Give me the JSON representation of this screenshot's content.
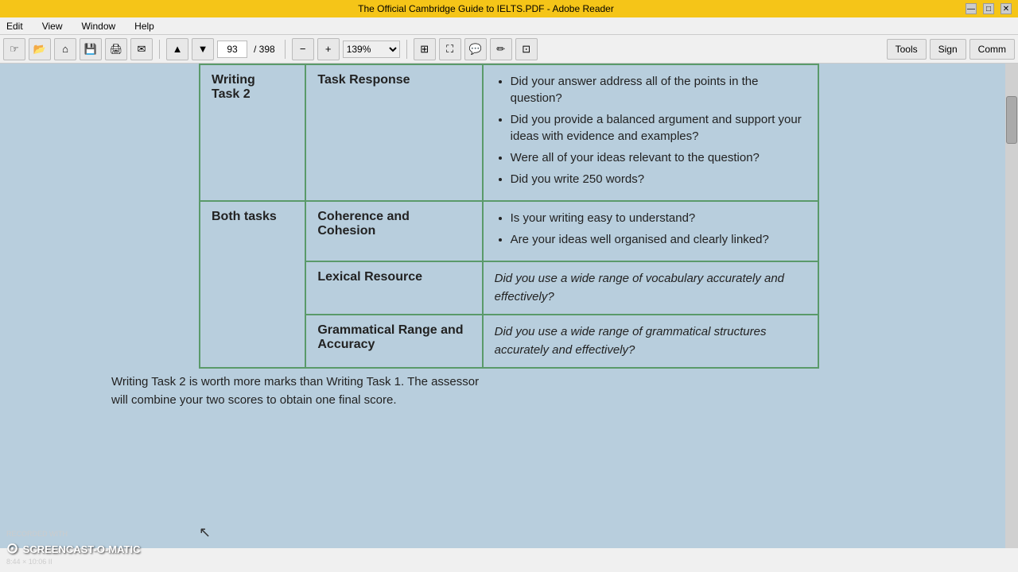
{
  "titlebar": {
    "title": "The Official Cambridge Guide to IELTS.PDF - Adobe Reader",
    "minimize": "—",
    "maximize": "□",
    "close": "✕"
  },
  "menubar": {
    "items": [
      "Edit",
      "View",
      "Window",
      "Help"
    ]
  },
  "toolbar": {
    "page_current": "93",
    "page_total": "/ 398",
    "zoom": "139%",
    "tools_label": "Tools",
    "sign_label": "Sign",
    "comm_label": "Comm"
  },
  "table": {
    "rows": [
      {
        "task": "Writing Task 2",
        "criterion": "Task Response",
        "questions": [
          "Did your answer address all of the points in the question?",
          "Did you provide a balanced argument and support your ideas with evidence and examples?",
          "Were all of your ideas relevant to the question?",
          "Did you write 250 words?"
        ]
      },
      {
        "task": "Both tasks",
        "criterion": "Coherence and Cohesion",
        "questions": [
          "Is your writing easy to understand?",
          "Are your ideas well organised and clearly linked?"
        ]
      },
      {
        "task": "",
        "criterion": "Lexical Resource",
        "questions_italic": "Did you use a wide range of vocabulary accurately and effectively?"
      },
      {
        "task": "",
        "criterion": "Grammatical Range and Accuracy",
        "questions_italic": "Did you use a wide range of grammatical structures accurately and effectively?"
      }
    ]
  },
  "bottom_text": {
    "line1": "Writing Task 2 is worth more marks than Writing Task 1. The assessor",
    "line2": "will combine your two scores to obtain one final score."
  },
  "watermark": {
    "recorded_with": "RECORDED WITH",
    "brand": "SCREENCAST-O-MATIC",
    "dims": "8:44 × 10:06 II"
  }
}
